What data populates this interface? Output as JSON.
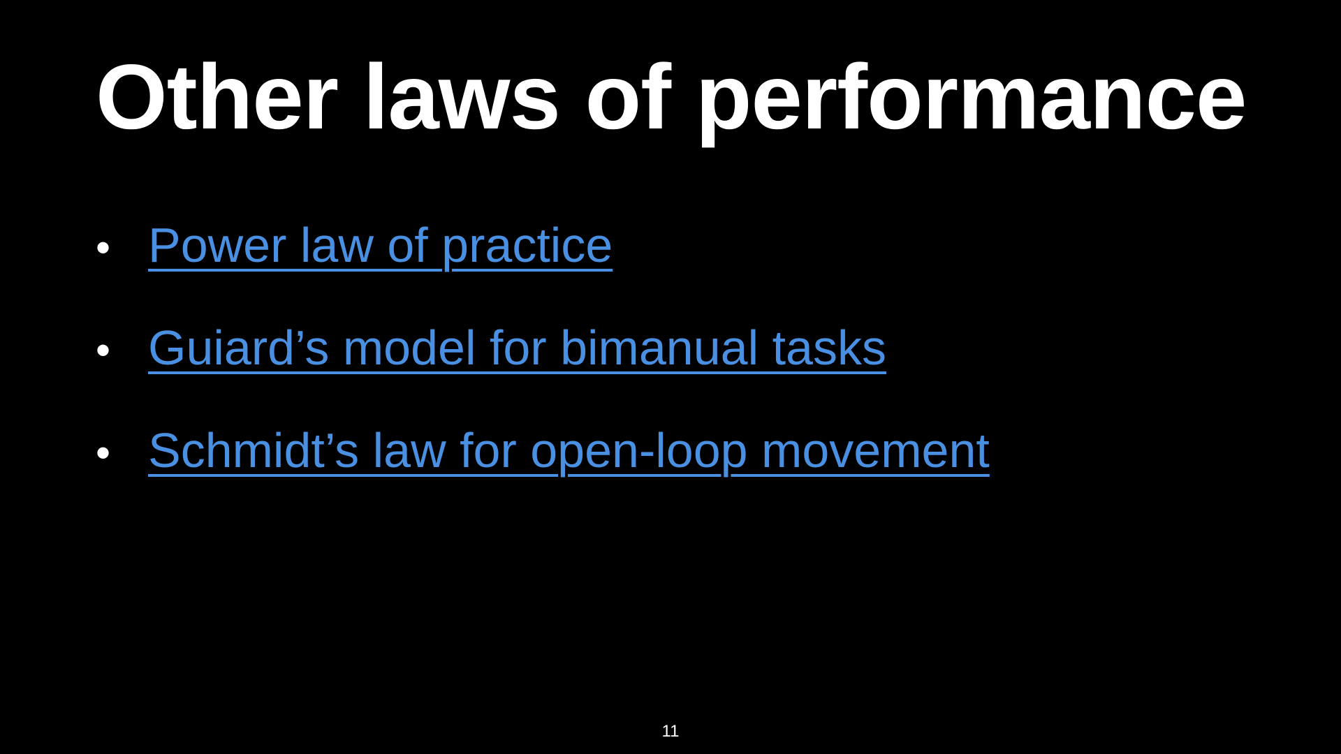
{
  "slide": {
    "title": "Other laws of performance",
    "bullets": [
      {
        "bullet": "•",
        "label": "Power law of practice"
      },
      {
        "bullet": "•",
        "label": "Guiard’s model for bimanual tasks"
      },
      {
        "bullet": "•",
        "label": "Schmidt’s law for open-loop movement"
      }
    ],
    "page_number": "11"
  },
  "colors": {
    "background": "#000000",
    "text": "#ffffff",
    "link": "#4a90e2"
  }
}
